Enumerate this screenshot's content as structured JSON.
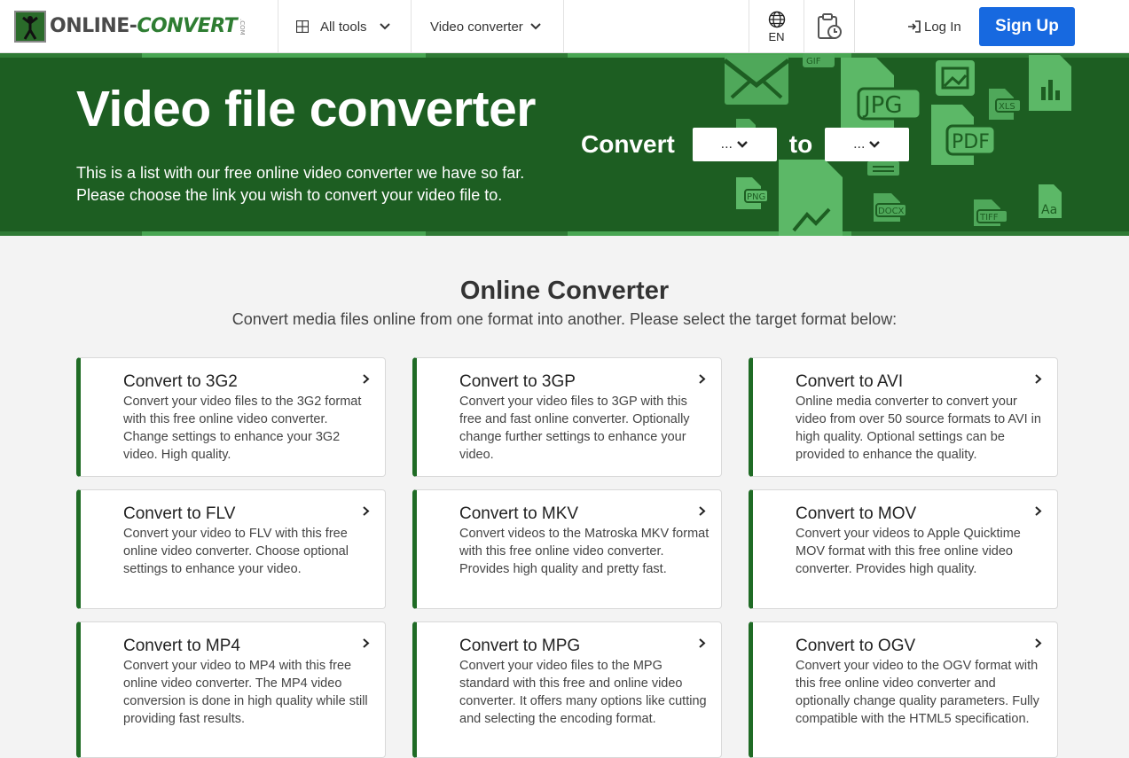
{
  "header": {
    "logo": {
      "text_main": "ONLINE-",
      "text_accent": "CONVERT",
      "text_suffix": ".COM"
    },
    "nav": [
      {
        "label": "All tools",
        "icon": "grid-icon"
      },
      {
        "label": "Video converter",
        "icon": "chevron-down-icon"
      }
    ],
    "language": "EN",
    "history_icon": "clipboard-clock-icon",
    "login_label": "Log In",
    "signup_label": "Sign Up"
  },
  "hero": {
    "title": "Video file converter",
    "description_line1": "This is a list with our free online video converter we have so far.",
    "description_line2": "Please choose the link you wish to convert your video file to.",
    "convert_label": "Convert",
    "to_label": "to",
    "from_select": "...",
    "to_select": "...",
    "art_labels": [
      "GIF",
      "JPG",
      "XLS",
      "PDF",
      "PNG",
      "DOCX",
      "TIFF",
      "Aa"
    ]
  },
  "section": {
    "title": "Online Converter",
    "subtitle": "Convert media files online from one format into another. Please select the target format below:"
  },
  "cards": [
    {
      "title": "Convert to 3G2",
      "desc": "Convert your video files to the 3G2 format with this free online video converter. Change settings to enhance your 3G2 video. High quality."
    },
    {
      "title": "Convert to 3GP",
      "desc": "Convert your video files to 3GP with this free and fast online converter. Optionally change further settings to enhance your video."
    },
    {
      "title": "Convert to AVI",
      "desc": "Online media converter to convert your video from over 50 source formats to AVI in high quality. Optional settings can be provided to enhance the quality."
    },
    {
      "title": "Convert to FLV",
      "desc": "Convert your video to FLV with this free online video converter. Choose optional settings to enhance your video."
    },
    {
      "title": "Convert to MKV",
      "desc": "Convert videos to the Matroska MKV format with this free online video converter. Provides high quality and pretty fast."
    },
    {
      "title": "Convert to MOV",
      "desc": "Convert your videos to Apple Quicktime MOV format with this free online video converter. Provides high quality."
    },
    {
      "title": "Convert to MP4",
      "desc": "Convert your video to MP4 with this free online video converter. The MP4 video conversion is done in high quality while still providing fast results."
    },
    {
      "title": "Convert to MPG",
      "desc": "Convert your video files to the MPG standard with this free and online video converter. It offers many options like cutting and selecting the encoding format."
    },
    {
      "title": "Convert to OGV",
      "desc": "Convert your video to the OGV format with this free online video converter and optionally change quality parameters. Fully compatible with the HTML5 specification."
    }
  ],
  "colors": {
    "hero_green": "#1d5e22",
    "accent_green": "#49a653",
    "card_border_green": "#1f6b25",
    "signup_blue": "#1769e0"
  }
}
